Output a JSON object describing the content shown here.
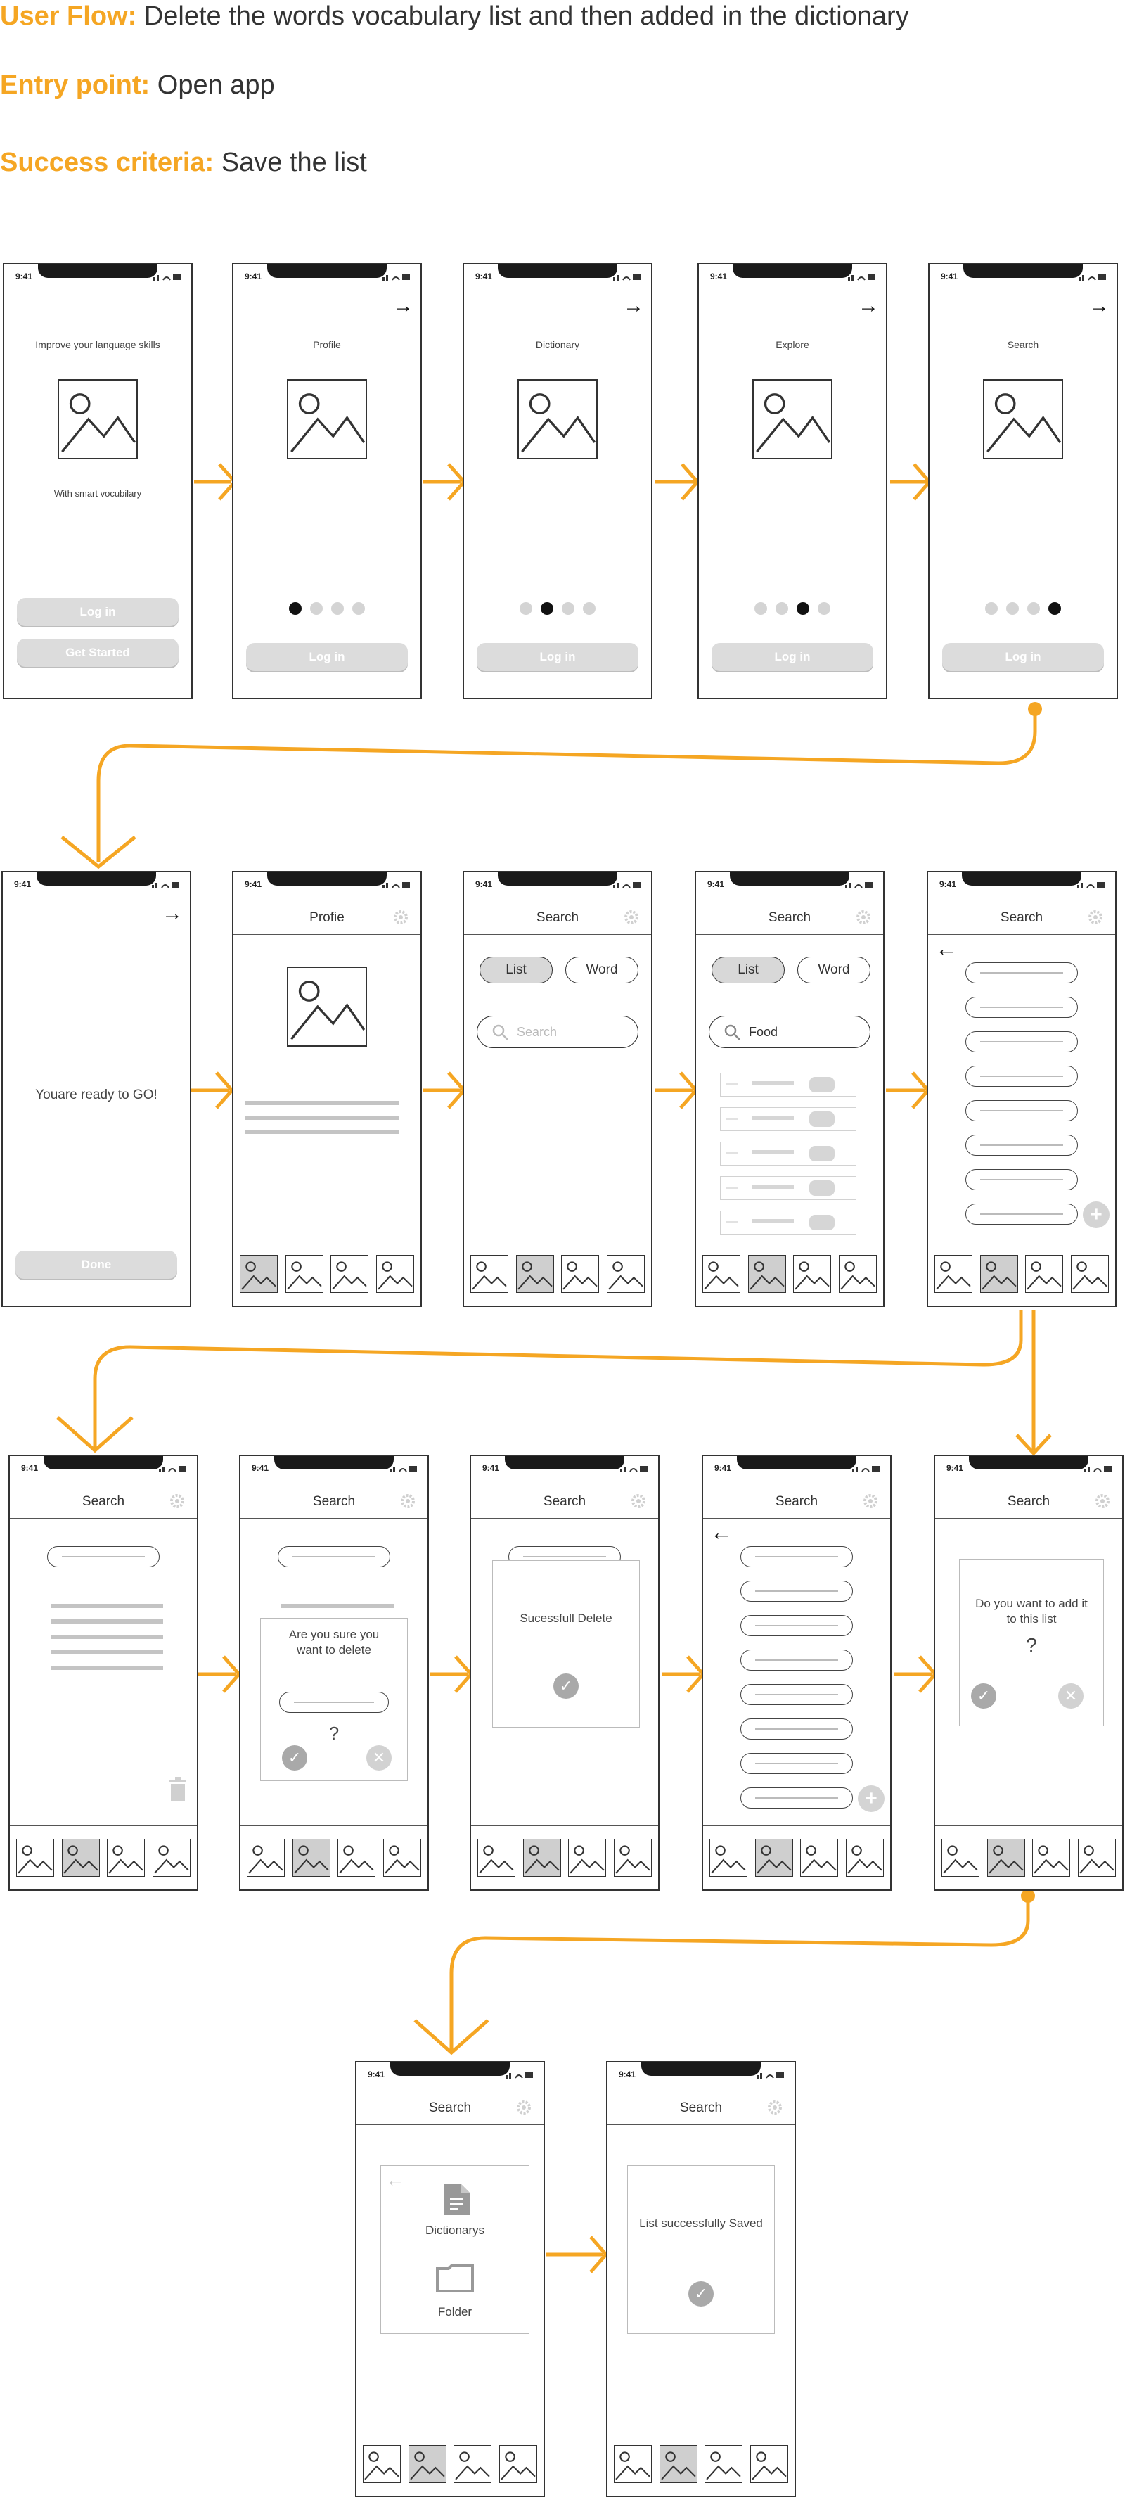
{
  "header": {
    "user_flow_label": "User Flow:",
    "user_flow_text": "Delete the words vocabulary list and then added in the dictionary",
    "entry_label": "Entry point:",
    "entry_text": "Open app",
    "success_label": "Success criteria:",
    "success_text": "Save the list"
  },
  "common": {
    "time": "9:41",
    "login": "Log in",
    "get_started": "Get Started",
    "done": "Done",
    "search_title": "Search",
    "list_tab": "List",
    "word_tab": "Word",
    "search_placeholder": "Search",
    "food_query": "Food",
    "question_mark": "?"
  },
  "onboarding": {
    "s1_headline": "Improve your language skills",
    "s1_sub": "With smart vocubilary",
    "s2_title": "Profile",
    "s3_title": "Dictionary",
    "s4_title": "Explore",
    "s5_title": "Search"
  },
  "screens": {
    "ready_text": "Youare ready to GO!",
    "profile_title": "Profie",
    "confirm_delete": "Are you sure you want to delete",
    "delete_success": "Sucessfull Delete",
    "add_prompt": "Do you want to add it to this list",
    "dictionary_option": "Dictionarys",
    "folder_option": "Folder",
    "saved_text": "List successfully Saved"
  },
  "colors": {
    "accent": "#f5a623",
    "frame": "#333333",
    "placeholder_gray": "#d4d4d4"
  }
}
